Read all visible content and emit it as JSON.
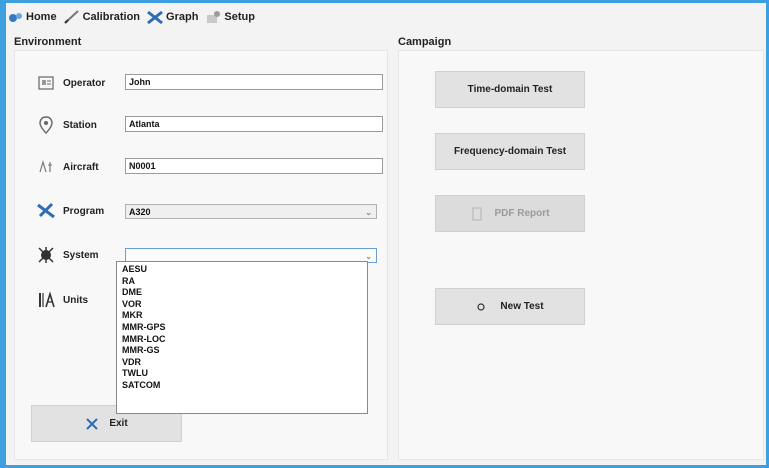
{
  "tabs": [
    {
      "label": "Home",
      "icon": "home-icon"
    },
    {
      "label": "Calibration",
      "icon": "pen-icon"
    },
    {
      "label": "Graph",
      "icon": "graph-icon"
    },
    {
      "label": "Setup",
      "icon": "setup-icon"
    }
  ],
  "environment": {
    "title": "Environment",
    "operator": {
      "label": "Operator",
      "value": "John",
      "icon": "operator-icon"
    },
    "station": {
      "label": "Station",
      "value": "Atlanta",
      "icon": "location-pin-icon"
    },
    "aircraft": {
      "label": "Aircraft",
      "value": "N0001",
      "icon": "aircraft-icon"
    },
    "program": {
      "label": "Program",
      "value": "A320",
      "icon": "airplane-icon"
    },
    "system": {
      "label": "System",
      "value": "",
      "icon": "system-icon"
    },
    "units": {
      "label": "Units",
      "icon": "units-icon"
    },
    "system_options": [
      "AESU",
      "RA",
      "DME",
      "VOR",
      "MKR",
      "MMR-GPS",
      "MMR-LOC",
      "MMR-GS",
      "VDR",
      "TWLU",
      "SATCOM"
    ],
    "exit_label": "Exit"
  },
  "campaign": {
    "title": "Campaign",
    "time_domain_label": "Time-domain Test",
    "frequency_domain_label": "Frequency-domain Test",
    "pdf_report_label": "PDF Report",
    "new_test_label": "New Test"
  }
}
